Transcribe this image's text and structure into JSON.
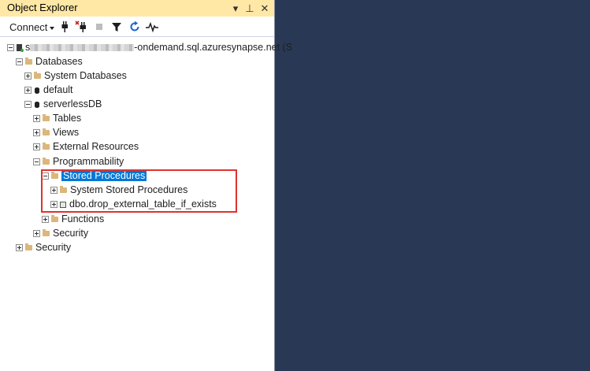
{
  "panel": {
    "title": "Object Explorer",
    "controls": {
      "dropdown": "▾",
      "pin": "⊥",
      "close": "✕"
    }
  },
  "toolbar": {
    "connect_label": "Connect",
    "icons": [
      "connect-object-explorer-icon",
      "disconnect-icon",
      "stop-icon",
      "filter-icon",
      "refresh-icon",
      "activity-monitor-icon"
    ]
  },
  "tree": {
    "server_prefix": "s",
    "server_suffix": "-ondemand.sql.azuresynapse.net (S",
    "databases": "Databases",
    "system_databases": "System Databases",
    "default_db": "default",
    "serverless_db": "serverlessDB",
    "tables": "Tables",
    "views": "Views",
    "external_resources": "External Resources",
    "programmability": "Programmability",
    "stored_procedures": "Stored Procedures",
    "system_stored_procedures": "System Stored Procedures",
    "drop_proc": "dbo.drop_external_table_if_exists",
    "functions": "Functions",
    "db_security": "Security",
    "server_security": "Security"
  },
  "colors": {
    "title_bar": "#ffe8a6",
    "background": "#293955",
    "selection": "#0078d7",
    "highlight_border": "#e0322d",
    "folder": "#dcb67a"
  }
}
